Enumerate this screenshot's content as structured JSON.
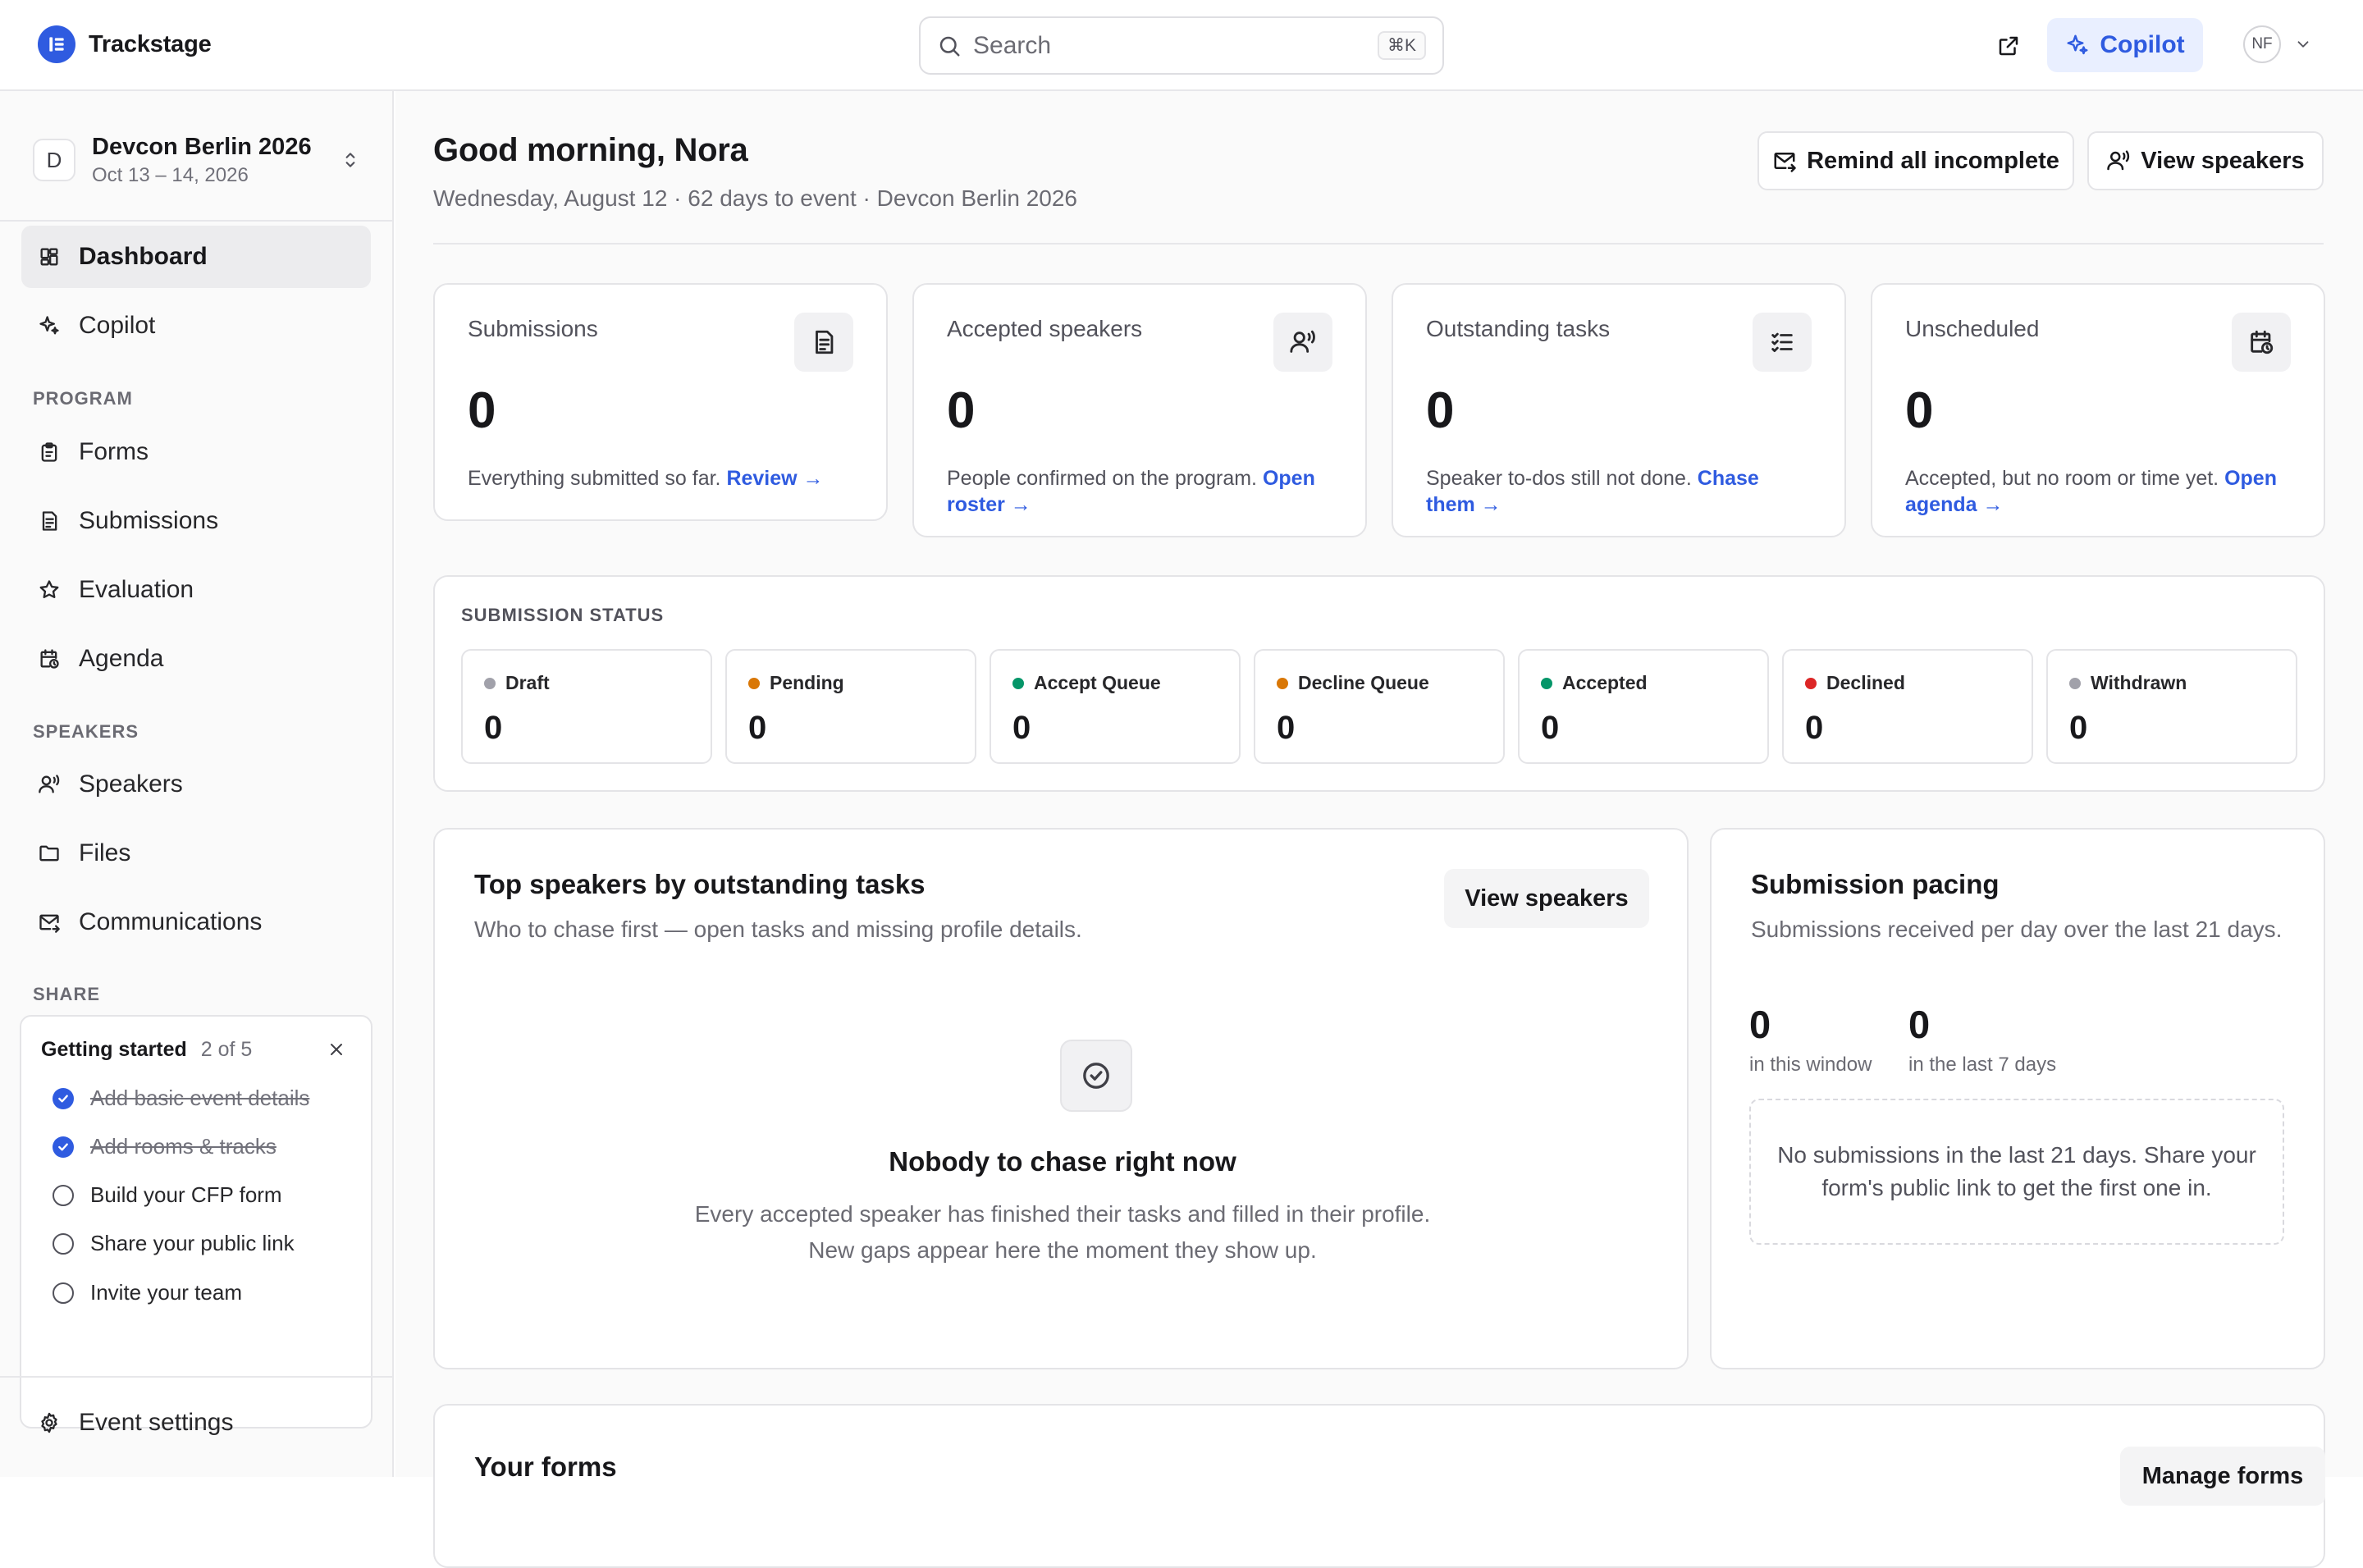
{
  "app": {
    "name": "Trackstage"
  },
  "search": {
    "placeholder": "Search",
    "shortcut": "⌘K"
  },
  "topbar": {
    "copilot_label": "Copilot",
    "user_initials": "NF"
  },
  "event": {
    "badge": "D",
    "name": "Devcon Berlin 2026",
    "dates": "Oct 13 – 14, 2026"
  },
  "nav": {
    "dashboard": "Dashboard",
    "copilot": "Copilot",
    "program_label": "PROGRAM",
    "forms": "Forms",
    "submissions": "Submissions",
    "evaluation": "Evaluation",
    "agenda": "Agenda",
    "speakers_label": "SPEAKERS",
    "speakers": "Speakers",
    "files": "Files",
    "communications": "Communications",
    "share_label": "SHARE",
    "event_settings": "Event settings"
  },
  "getting_started": {
    "title": "Getting started",
    "progress": "2 of 5",
    "items": [
      {
        "label": "Add basic event details",
        "done": true
      },
      {
        "label": "Add rooms & tracks",
        "done": true
      },
      {
        "label": "Build your CFP form",
        "done": false
      },
      {
        "label": "Share your public link",
        "done": false
      },
      {
        "label": "Invite your team",
        "done": false
      }
    ]
  },
  "header": {
    "greeting": "Good morning, Nora",
    "subline": "Wednesday, August 12 · 62 days to event · Devcon Berlin 2026",
    "remind_label": "Remind all incomplete",
    "view_speakers_label": "View speakers"
  },
  "stats": [
    {
      "label": "Submissions",
      "value": "0",
      "desc": "Everything submitted so far.",
      "link": "Review →",
      "icon": "document-icon"
    },
    {
      "label": "Accepted speakers",
      "value": "0",
      "desc": "People confirmed on the program.",
      "link": "Open roster →",
      "icon": "speaker-icon"
    },
    {
      "label": "Outstanding tasks",
      "value": "0",
      "desc": "Speaker to-dos still not done.",
      "link": "Chase them →",
      "icon": "checklist-icon"
    },
    {
      "label": "Unscheduled",
      "value": "0",
      "desc": "Accepted, but no room or time yet.",
      "link": "Open agenda →",
      "icon": "calendar-clock-icon"
    }
  ],
  "submission_status": {
    "title": "SUBMISSION STATUS",
    "items": [
      {
        "label": "Draft",
        "value": "0",
        "color": "#a1a1aa"
      },
      {
        "label": "Pending",
        "value": "0",
        "color": "#d97706"
      },
      {
        "label": "Accept Queue",
        "value": "0",
        "color": "#059669"
      },
      {
        "label": "Decline Queue",
        "value": "0",
        "color": "#d97706"
      },
      {
        "label": "Accepted",
        "value": "0",
        "color": "#059669"
      },
      {
        "label": "Declined",
        "value": "0",
        "color": "#dc2626"
      },
      {
        "label": "Withdrawn",
        "value": "0",
        "color": "#a1a1aa"
      }
    ]
  },
  "top_speakers": {
    "title": "Top speakers by outstanding tasks",
    "subtitle": "Who to chase first — open tasks and missing profile details.",
    "button": "View speakers",
    "empty_title": "Nobody to chase right now",
    "empty_desc": "Every accepted speaker has finished their tasks and filled in their profile. New gaps appear here the moment they show up."
  },
  "pacing": {
    "title": "Submission pacing",
    "subtitle": "Submissions received per day over the last 21 days.",
    "window_value": "0",
    "window_label": "in this window",
    "week_value": "0",
    "week_label": "in the last 7 days",
    "empty": "No submissions in the last 21 days. Share your form's public link to get the first one in."
  },
  "forms": {
    "title": "Your forms",
    "button": "Manage forms"
  },
  "colors": {
    "accent": "#2f5be0",
    "accent_bg": "#e9efff"
  }
}
